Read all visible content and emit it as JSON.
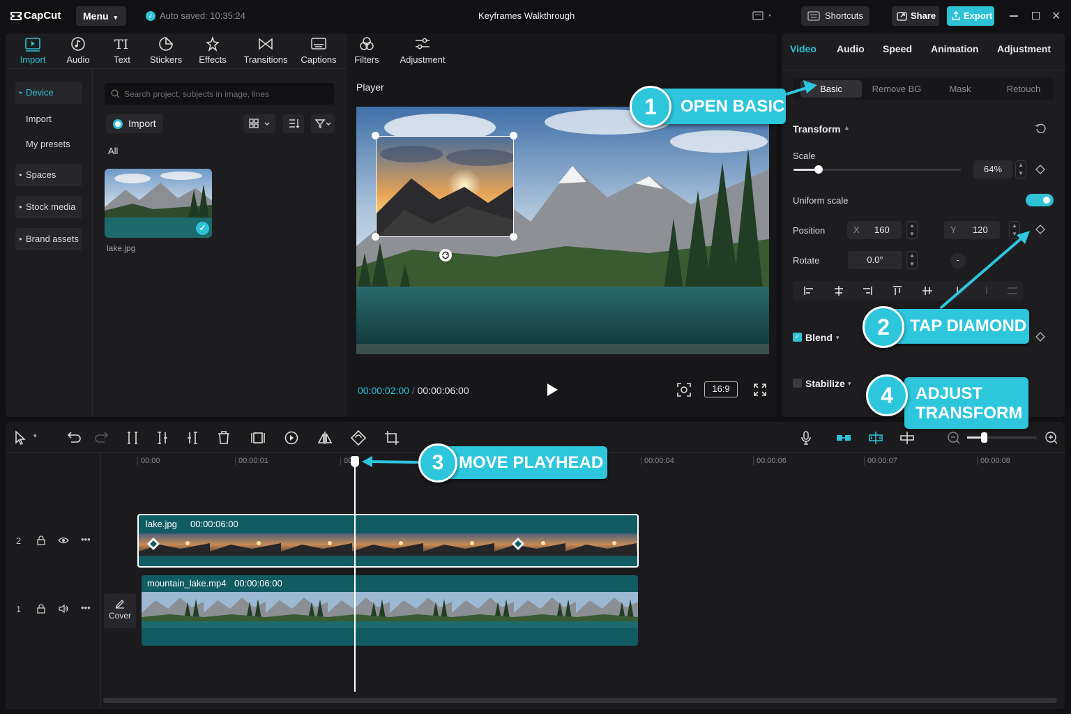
{
  "app": {
    "name": "CapCut",
    "menu_label": "Menu",
    "autosave": "Auto saved: 10:35:24",
    "project_title": "Keyframes Walkthrough",
    "shortcuts": "Shortcuts",
    "share": "Share",
    "export": "Export"
  },
  "toolbar": [
    {
      "label": "Import",
      "icon": "import-icon"
    },
    {
      "label": "Audio",
      "icon": "audio-icon"
    },
    {
      "label": "Text",
      "icon": "text-icon"
    },
    {
      "label": "Stickers",
      "icon": "stickers-icon"
    },
    {
      "label": "Effects",
      "icon": "effects-icon"
    },
    {
      "label": "Transitions",
      "icon": "transitions-icon"
    },
    {
      "label": "Captions",
      "icon": "captions-icon"
    },
    {
      "label": "Filters",
      "icon": "filters-icon"
    },
    {
      "label": "Adjustment",
      "icon": "adjustment-icon"
    }
  ],
  "sidebar": {
    "items": [
      "Device",
      "Import",
      "My presets",
      "Spaces",
      "Stock media",
      "Brand assets"
    ]
  },
  "media": {
    "search_placeholder": "Search project, subjects in image, lines",
    "import_label": "Import",
    "filter_all": "All",
    "file_name": "lake.jpg"
  },
  "player": {
    "title": "Player",
    "current_time": "00:00:02:00",
    "separator": "/",
    "total_time": "00:00:06:00",
    "aspect": "16:9"
  },
  "props": {
    "tabs": [
      "Video",
      "Audio",
      "Speed",
      "Animation",
      "Adjustment"
    ],
    "subtabs": [
      "Basic",
      "Remove BG",
      "Mask",
      "Retouch"
    ],
    "transform_label": "Transform",
    "scale_label": "Scale",
    "scale_value": "64%",
    "scale_fraction": 0.15,
    "uniform_label": "Uniform scale",
    "position_label": "Position",
    "x_label": "X",
    "x_value": "160",
    "y_label": "Y",
    "y_value": "120",
    "rotate_label": "Rotate",
    "rotate_value": "0.0°",
    "blend_label": "Blend",
    "stabilize_label": "Stabilize"
  },
  "timeline": {
    "ticks": [
      "00:00",
      "00:00:01",
      "00:00:04",
      "00:00:06",
      "00:00:07",
      "00:00:08"
    ],
    "track2": {
      "num": "2",
      "clip_name": "lake.jpg",
      "clip_duration": "00:00:06:00"
    },
    "track1": {
      "num": "1",
      "clip_name": "mountain_lake.mp4",
      "clip_duration": "00:00:06:00"
    },
    "cover_label": "Cover"
  },
  "callouts": [
    {
      "num": "1",
      "text": "OPEN BASIC"
    },
    {
      "num": "2",
      "text": "TAP DIAMOND"
    },
    {
      "num": "3",
      "text": "MOVE PLAYHEAD"
    },
    {
      "num": "4",
      "text_line1": "ADJUST",
      "text_line2": "TRANSFORM"
    }
  ],
  "colors": {
    "accent": "#2fc2d6",
    "callout": "#2ec6dd",
    "clip": "#115c62",
    "bg": "#111113",
    "panel": "#1d1d20"
  }
}
